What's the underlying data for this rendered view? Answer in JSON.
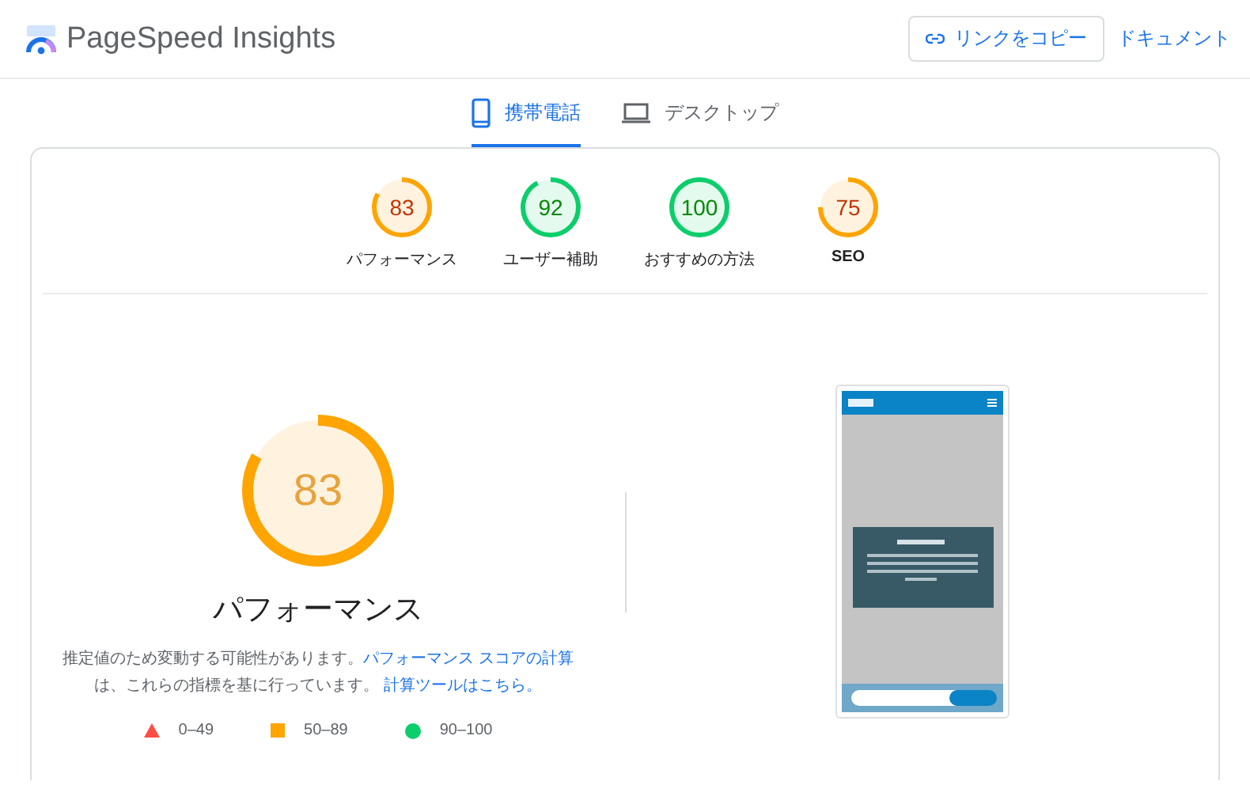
{
  "header": {
    "title": "PageSpeed Insights",
    "copy_button": "リンクをコピー",
    "docs_link": "ドキュメント"
  },
  "tabs": [
    {
      "label": "携帯電話",
      "kind": "phone",
      "selected": true
    },
    {
      "label": "デスクトップ",
      "kind": "desktop",
      "selected": false
    }
  ],
  "categories": [
    {
      "score": "83",
      "label": "パフォーマンス",
      "level": 0.83
    },
    {
      "score": "92",
      "label": "ユーザー補助",
      "level": 0.92
    },
    {
      "score": "100",
      "label": "おすすめの方法",
      "level": 1
    },
    {
      "score": "75",
      "label": "SEO",
      "level": 0.75
    }
  ],
  "performance": {
    "score": "83",
    "level": 0.83,
    "title": "パフォーマンス",
    "description": "推定値のため変動する可能性があります。",
    "score_link": "パフォーマンス スコアの計算",
    "description_2": "は、これらの指標を基に行っています。",
    "calculator_link": "計算ツールはこちら。",
    "legend": [
      {
        "kind": "fail",
        "range": "0–49"
      },
      {
        "kind": "average",
        "range": "50–89"
      },
      {
        "kind": "pass",
        "range": "90–100"
      }
    ]
  }
}
